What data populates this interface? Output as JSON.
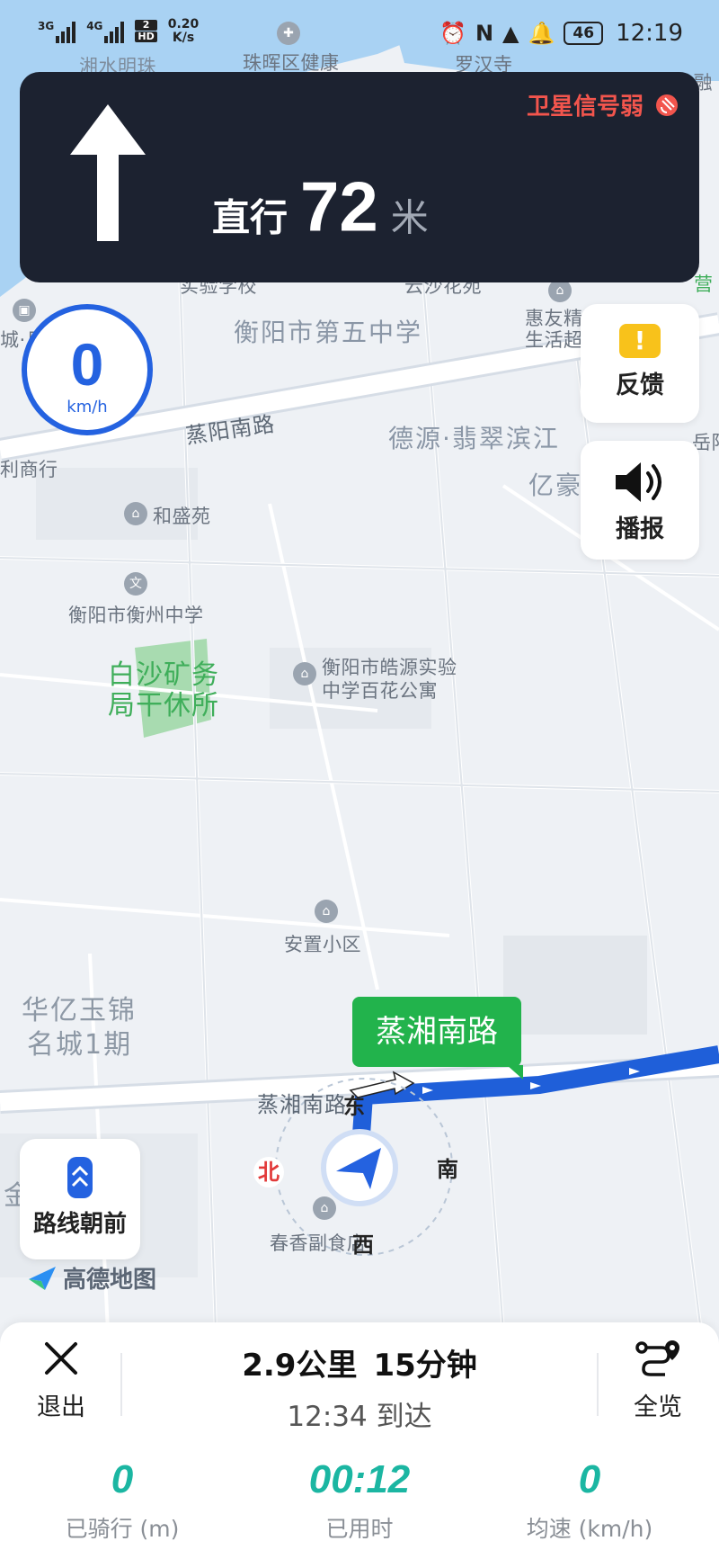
{
  "status_bar": {
    "network_1": "3G",
    "network_2": "4G",
    "hd_top": "2",
    "hd_bottom": "HD",
    "data_speed_value": "0.20",
    "data_speed_unit": "K/s",
    "battery": "46",
    "time": "12:19"
  },
  "navigation": {
    "action": "直行",
    "distance": "72",
    "unit": "米",
    "gps_warning": "卫星信号弱"
  },
  "speedometer": {
    "value": "0",
    "unit": "km/h"
  },
  "side_buttons": {
    "feedback": "反馈",
    "broadcast": "播报"
  },
  "route_forward_label": "路线朝前",
  "map": {
    "labels": {
      "l1": "湘水明珠",
      "l2": "珠晖区健康",
      "l3": "罗汉寺",
      "l4": "金融",
      "l5": "实验学校",
      "l6": "云沙花苑",
      "l7": "营",
      "l8": "城·月",
      "l9": "衡阳市第五中学",
      "l10": "惠友精",
      "l11": "生活超",
      "l12": "蒸阳南路",
      "l13": "德源·翡翠滨江",
      "l14": "岳阳",
      "l15": "利商行",
      "l16": "亿豪",
      "l17": "和盛苑",
      "l18": "衡阳市衡州中学",
      "l19": "白沙矿务",
      "l20": "局干休所",
      "l21": "衡阳市皓源实验",
      "l22": "中学百花公寓",
      "l23": "安置小区",
      "l24": "华亿玉锦",
      "l25": "名城1期",
      "l26": "蒸湘南路",
      "l27": "春香副食店",
      "l28": "金"
    },
    "street_tag": "蒸湘南路",
    "compass": {
      "north": "北",
      "south": "南",
      "east": "东",
      "west": "西"
    },
    "logo_text": "高德地图"
  },
  "bottom": {
    "exit": "退出",
    "overview": "全览",
    "remaining_distance": "2.9公里",
    "remaining_time": "15分钟",
    "arrival": "12:34 到达",
    "stats": [
      {
        "value": "0",
        "label": "已骑行 (m)"
      },
      {
        "value": "00:12",
        "label": "已用时"
      },
      {
        "value": "0",
        "label": "均速 (km/h)"
      }
    ]
  },
  "colors": {
    "banner_bg": "#1c2230",
    "warning": "#f2554d",
    "accent_blue": "#2462e0",
    "route_blue": "#1f5fd9",
    "street_green": "#22b34c",
    "stat_teal": "#1bb6a2",
    "feedback_yellow": "#f8c21b"
  }
}
